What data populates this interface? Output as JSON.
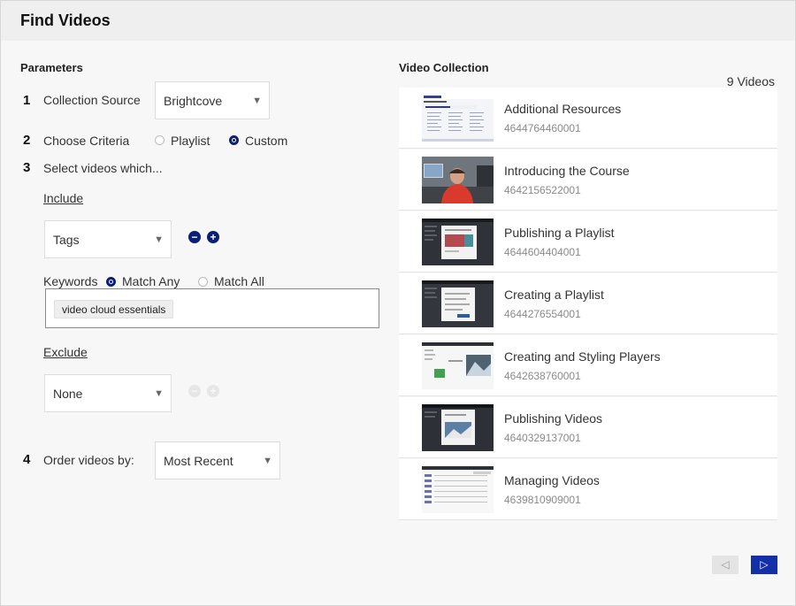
{
  "header": {
    "title": "Find Videos"
  },
  "params": {
    "title": "Parameters",
    "steps": {
      "s1": {
        "num": "1",
        "label": "Collection Source",
        "select": "Brightcove"
      },
      "s2": {
        "num": "2",
        "label": "Choose Criteria",
        "opt_playlist": "Playlist",
        "opt_custom": "Custom",
        "selected": "Custom"
      },
      "s3": {
        "num": "3",
        "label": "Select videos which..."
      },
      "s4": {
        "num": "4",
        "label": "Order videos by:",
        "select": "Most Recent"
      }
    },
    "include": {
      "label": "Include",
      "select": "Tags",
      "keywords_label": "Keywords",
      "match_any": "Match Any",
      "match_all": "Match All",
      "match_selected": "Match Any",
      "chip": "video cloud essentials"
    },
    "exclude": {
      "label": "Exclude",
      "select": "None"
    }
  },
  "collection": {
    "title": "Video Collection",
    "count": "9 Videos",
    "videos": [
      {
        "title": "Additional Resources",
        "id": "4644764460001",
        "thumb": "doc-thumb"
      },
      {
        "title": "Introducing the Course",
        "id": "4642156522001",
        "thumb": "presenter-thumb"
      },
      {
        "title": "Publishing a Playlist",
        "id": "4644604404001",
        "thumb": "dark-ui-thumb"
      },
      {
        "title": "Creating a Playlist",
        "id": "4644276554001",
        "thumb": "dark-ui-thumb"
      },
      {
        "title": "Creating and Styling Players",
        "id": "4642638760001",
        "thumb": "player-thumb"
      },
      {
        "title": "Publishing Videos",
        "id": "4640329137001",
        "thumb": "dark-ui-thumb"
      },
      {
        "title": "Managing Videos",
        "id": "4639810909001",
        "thumb": "list-ui-thumb"
      }
    ]
  },
  "pagination": {
    "prev": "◁",
    "next": "▷"
  },
  "colors": {
    "accent": "#0b1f77",
    "next_button": "#1430a8"
  }
}
